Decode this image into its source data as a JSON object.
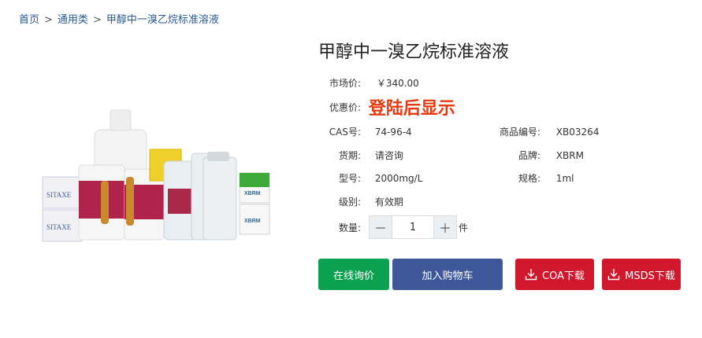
{
  "breadcrumb": {
    "home": "首页",
    "separator": ">",
    "category": "通用类",
    "current": "甲醇中一溴乙烷标准溶液"
  },
  "product": {
    "title": "甲醇中一溴乙烷标准溶液",
    "image_alt": "产品图片",
    "market_price_label": "市场价:",
    "market_price": "￥340.00",
    "promo_label": "优惠价:",
    "promo_text": "登陆后显示",
    "cas_label": "CAS号:",
    "cas": "74-96-4",
    "code_label": "商品编号:",
    "code": "XB03264",
    "supply_label": "货期:",
    "supply": "请咨询",
    "brand_label": "品牌:",
    "brand": "XBRM",
    "model_label": "型号:",
    "model": "2000mg/L",
    "spec_label": "规格:",
    "spec": "1ml",
    "grade_label": "级别:",
    "grade": "有效期",
    "qty_label": "数量:",
    "qty_minus": "－",
    "qty_value": "1",
    "qty_plus": "＋",
    "qty_unit": "件"
  },
  "buttons": {
    "inquiry": "在线询价",
    "cart": "加入购物车",
    "coa": "COA下载",
    "msds": "MSDS下载"
  },
  "colors": {
    "inquiry": "#0aa150",
    "cart": "#3d579a",
    "download": "#d0172c",
    "promo": "#e8380d",
    "link": "#2a5a8f"
  }
}
